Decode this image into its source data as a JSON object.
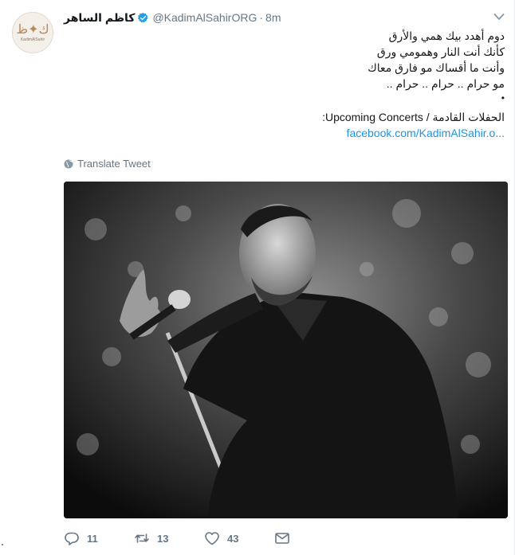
{
  "tweet": {
    "display_name": "كاظم الساهر",
    "handle": "@KadimAlSahirORG",
    "separator": "·",
    "time": "8m",
    "avatar_text": "KadimAlSahir",
    "lines": [
      "دوم أهدد بيك همي والأرق",
      "كأنك أنت النار وهمومي ورق",
      "وأنت ما أقساك مو فارق معاك",
      "مو حرام .. حرام .. حرام .."
    ],
    "bullet": "•",
    "concerts_line": "الحفلات القادمة / Upcoming Concerts:",
    "link": "facebook.com/KadimAlSahir.o...",
    "translate_label": "Translate Tweet"
  },
  "actions": {
    "reply_count": "11",
    "retweet_count": "13",
    "like_count": "43"
  },
  "icons": [
    "verified-icon",
    "caret-down-icon",
    "globe-icon",
    "reply-icon",
    "retweet-icon",
    "like-icon",
    "direct-message-icon"
  ],
  "colors": {
    "link": "#1b95e0",
    "secondary": "#657786",
    "verified": "#1da1f2"
  }
}
